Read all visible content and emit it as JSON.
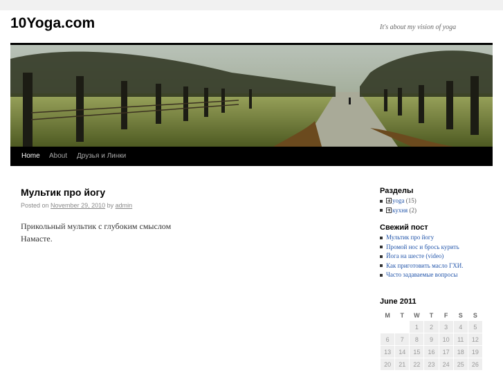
{
  "site": {
    "title": "10Yoga.com",
    "description": "It's about my vision of yoga"
  },
  "nav": {
    "items": [
      "Home",
      "About",
      "Друзья и Линки"
    ]
  },
  "post": {
    "title": "Мультик про йогу",
    "meta_prefix": "Posted on",
    "date": "November 29, 2010",
    "meta_by": "by",
    "author": "admin",
    "body": [
      "Прикольный мультик с глубоким смыслом",
      "Намасте."
    ]
  },
  "widgets": {
    "categories": {
      "title": "Разделы",
      "items": [
        {
          "label": "yoga",
          "count": "(15)"
        },
        {
          "label": "кухня",
          "count": "(2)"
        }
      ]
    },
    "recent": {
      "title": "Свежий пост",
      "items": [
        "Мультик про йогу",
        "Промой нос и брось курить",
        "Йога на шесте (video)",
        "Как приготовить масло ГХИ.",
        "Часто задаваемые вопросы"
      ]
    }
  },
  "calendar": {
    "caption": "June 2011",
    "headers": [
      "M",
      "T",
      "W",
      "T",
      "F",
      "S",
      "S"
    ],
    "weeks": [
      [
        "",
        "",
        "1",
        "2",
        "3",
        "4",
        "5"
      ],
      [
        "6",
        "7",
        "8",
        "9",
        "10",
        "11",
        "12"
      ],
      [
        "13",
        "14",
        "15",
        "16",
        "17",
        "18",
        "19"
      ],
      [
        "20",
        "21",
        "22",
        "23",
        "24",
        "25",
        "26"
      ]
    ]
  },
  "colors": {
    "accent_link": "#2255aa",
    "nav_bg": "#000000"
  }
}
